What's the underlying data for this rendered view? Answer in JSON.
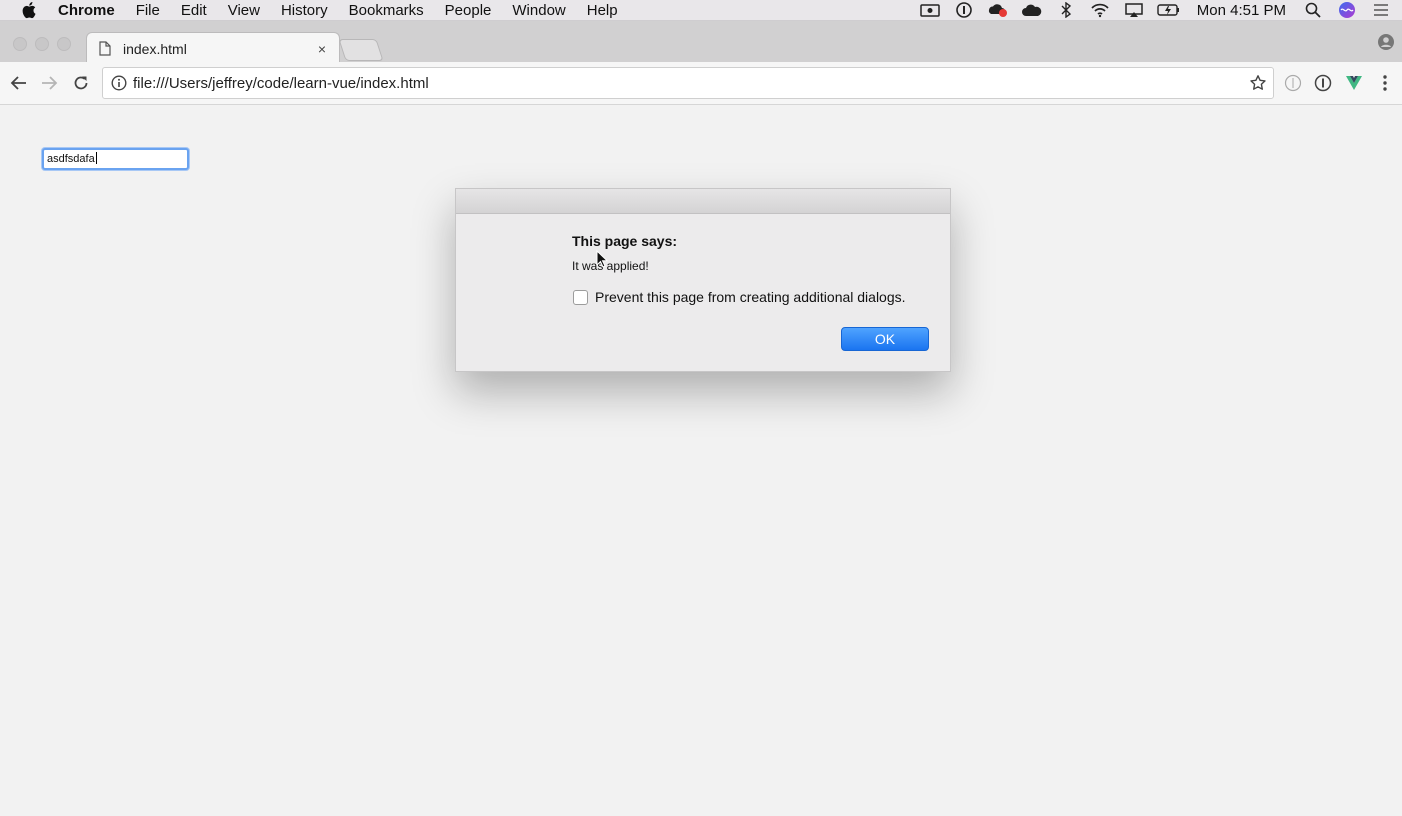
{
  "menubar": {
    "app_name": "Chrome",
    "items": [
      "File",
      "Edit",
      "View",
      "History",
      "Bookmarks",
      "People",
      "Window",
      "Help"
    ],
    "clock": "Mon 4:51 PM",
    "status_icons": [
      "screen-record-icon",
      "1password-icon",
      "creative-cloud-icon",
      "cloud-icon",
      "bluetooth-icon",
      "wifi-icon",
      "airplay-icon",
      "battery-icon",
      "spotlight-icon",
      "siri-icon",
      "notification-center-icon"
    ]
  },
  "tab": {
    "title": "index.html",
    "close": "×"
  },
  "toolbar": {
    "url": "file:///Users/jeffrey/code/learn-vue/index.html"
  },
  "page": {
    "input_value": "asdfsdafa"
  },
  "dialog": {
    "title": "This page says:",
    "message": "It was applied!",
    "prevent_label": "Prevent this page from creating additional dialogs.",
    "ok_label": "OK"
  },
  "colors": {
    "accent": "#1a74f0",
    "focus_ring": "#6aa3f0"
  }
}
